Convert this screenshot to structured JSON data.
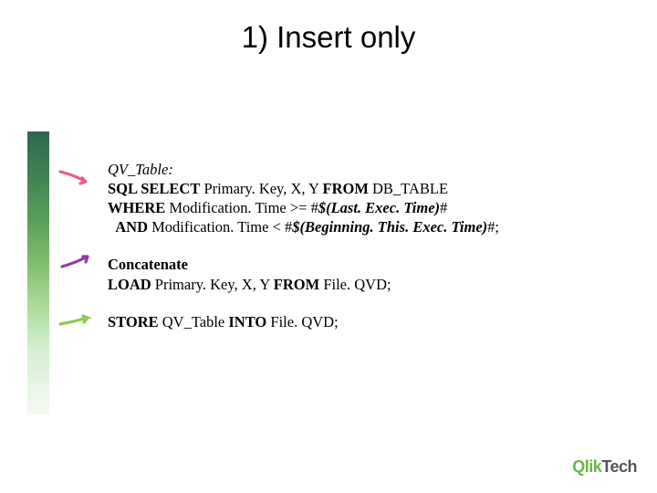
{
  "title": "1) Insert only",
  "code": {
    "qv_label": "QV_Table:",
    "sql": "SQL SELECT",
    "sql_cols": " Primary. Key, X, Y ",
    "from": "FROM",
    "db_table": " DB_TABLE",
    "where": "WHERE",
    "where_cond": " Modification. Time >= #",
    "last_exec": "$(Last. Exec. Time)",
    "hash1": "#",
    "and": "AND",
    "and_cond": " Modification. Time < #",
    "begin_exec": "$(Beginning. This. Exec. Time)",
    "hash2": "#;",
    "concat": "Concatenate",
    "load": "LOAD",
    "load_cols": " Primary. Key, X, Y ",
    "from2": "FROM",
    "file_qvd1": " File. QVD;",
    "store": "STORE",
    "store_tbl": " QV_Table ",
    "into": "INTO",
    "file_qvd2": " File. QVD;"
  },
  "logo": {
    "brand1": "Qlik",
    "brand2": "Tech"
  },
  "arrows": {
    "a1": {
      "color": "#e85a8f"
    },
    "a2": {
      "color": "#8a3fa0"
    },
    "a3": {
      "color": "#8fc94a"
    }
  }
}
